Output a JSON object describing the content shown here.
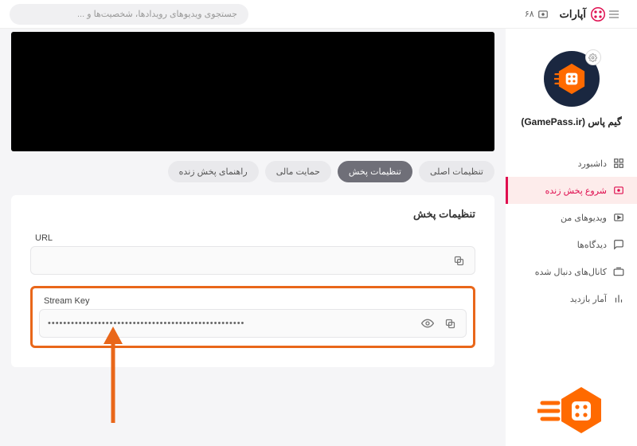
{
  "brand": {
    "name": "آپارات"
  },
  "header": {
    "points": "۶۸",
    "search_placeholder": "جستجوی ویدیوهای رویدادها، شخصیت‌ها و ..."
  },
  "channel": {
    "name": "گیم پاس (GamePass.ir)"
  },
  "sidebar": {
    "items": [
      {
        "label": "داشبورد"
      },
      {
        "label": "شروع پخش زنده"
      },
      {
        "label": "ویدیوهای من"
      },
      {
        "label": "دیدگاه‌ها"
      },
      {
        "label": "کانال‌های دنبال شده"
      },
      {
        "label": "آمار بازدید"
      }
    ]
  },
  "tabs": {
    "items": [
      {
        "label": "تنظیمات اصلی"
      },
      {
        "label": "تنظیمات پخش"
      },
      {
        "label": "حمایت مالی"
      },
      {
        "label": "راهنمای پخش زنده"
      }
    ]
  },
  "settings": {
    "title": "تنظیمات پخش",
    "url_label": "URL",
    "url_value": " ",
    "key_label": "Stream Key",
    "key_masked": "•••••••••••••••••••••••••••••••••••••••••••••••••••"
  }
}
